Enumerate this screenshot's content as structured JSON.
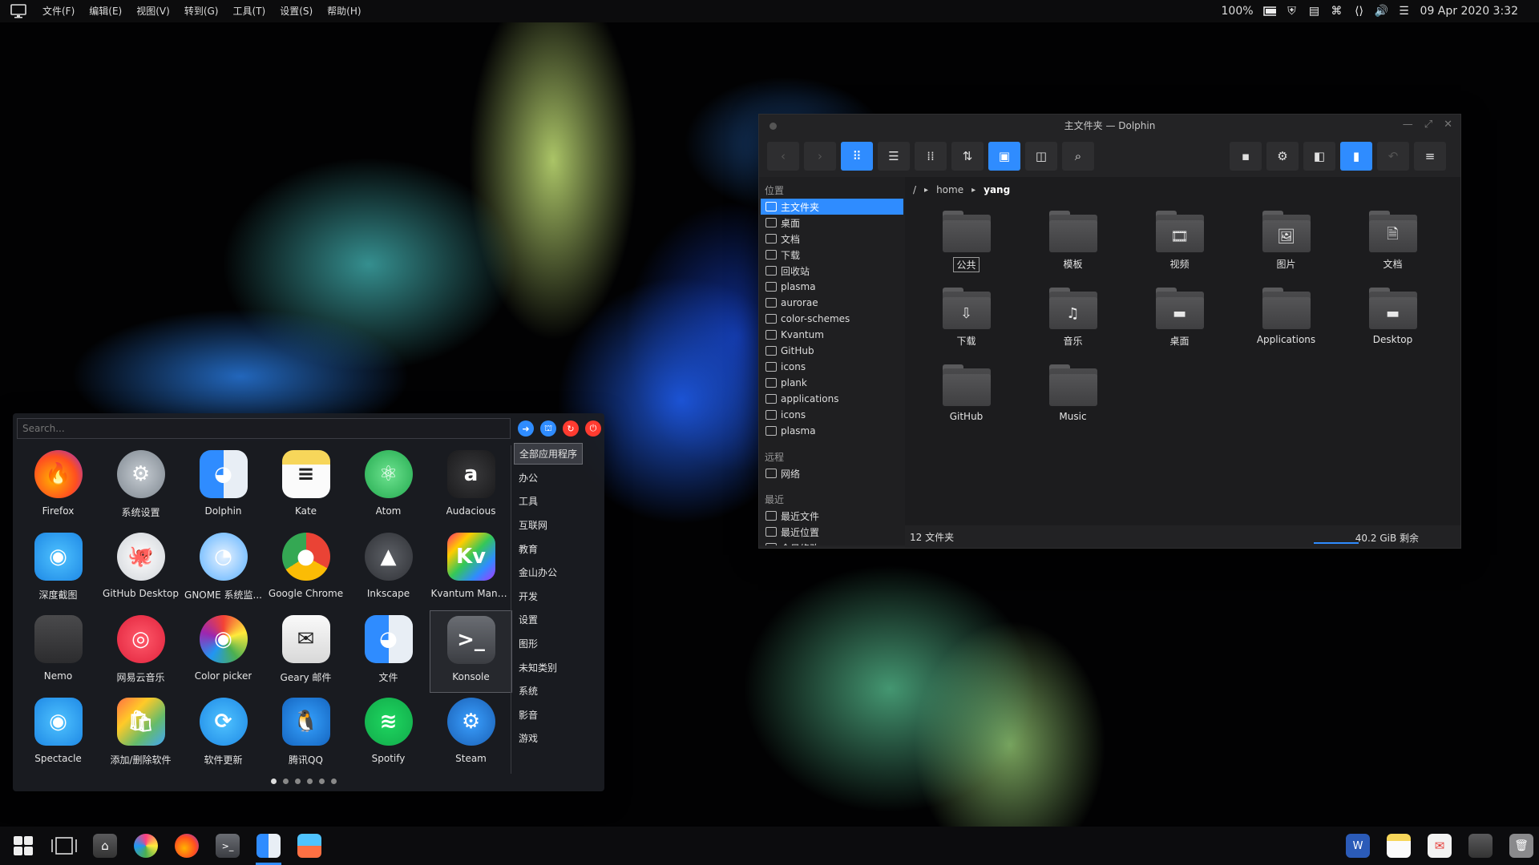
{
  "topbar": {
    "menu": [
      "文件(F)",
      "编辑(E)",
      "视图(V)",
      "转到(G)",
      "工具(T)",
      "设置(S)",
      "帮助(H)"
    ],
    "battery": "100%",
    "datetime": "09 Apr 2020 3:32"
  },
  "dolphin": {
    "title": "主文件夹 — Dolphin",
    "places_header": "位置",
    "places": [
      "主文件夹",
      "桌面",
      "文档",
      "下载",
      "回收站",
      "plasma",
      "aurorae",
      "color-schemes",
      "Kvantum",
      "GitHub",
      "icons",
      "plank",
      "applications",
      "icons",
      "plasma"
    ],
    "remote_header": "远程",
    "remote": [
      "网络"
    ],
    "recent_header": "最近",
    "recent": [
      "最近文件",
      "最近位置",
      "今日修改"
    ],
    "breadcrumb": [
      "/",
      "home",
      "yang"
    ],
    "files": [
      {
        "name": "公共",
        "glyph": ""
      },
      {
        "name": "模板",
        "glyph": ""
      },
      {
        "name": "视频",
        "glyph": "🎞"
      },
      {
        "name": "图片",
        "glyph": "🖼"
      },
      {
        "name": "文档",
        "glyph": "🗎"
      },
      {
        "name": "下载",
        "glyph": "⇩"
      },
      {
        "name": "音乐",
        "glyph": "♫"
      },
      {
        "name": "桌面",
        "glyph": "▬"
      },
      {
        "name": "Applications",
        "glyph": ""
      },
      {
        "name": "Desktop",
        "glyph": "▬"
      },
      {
        "name": "GitHub",
        "glyph": ""
      },
      {
        "name": "Music",
        "glyph": ""
      }
    ],
    "status": "12 文件夹",
    "free_space": "40.2 GiB 剩余"
  },
  "launcher": {
    "search_placeholder": "Search...",
    "apps": [
      {
        "name": "Firefox",
        "icon": "firefox-icon",
        "bg": "radial-gradient(circle at 40% 60%,#ffb300,#ff4f1f 55%,#8a2be2)",
        "glyph": "🔥"
      },
      {
        "name": "系统设置",
        "icon": "settings-icon",
        "bg": "radial-gradient(circle,#c7cdd3,#7d868f)",
        "glyph": "⚙"
      },
      {
        "name": "Dolphin",
        "icon": "dolphin-icon",
        "bg": "linear-gradient(90deg,#2f8cff 50%,#e8eef5 50%)",
        "glyph": "◕"
      },
      {
        "name": "Kate",
        "icon": "kate-icon",
        "bg": "linear-gradient(#f7d65a 30%,#fbfbfb 30%)",
        "glyph": "≡"
      },
      {
        "name": "Atom",
        "icon": "atom-icon",
        "bg": "radial-gradient(circle,#6de38f,#22a84e)",
        "glyph": "⚛"
      },
      {
        "name": "Audacious",
        "icon": "audacious-icon",
        "bg": "radial-gradient(circle,#3a3a3c,#1a1a1c)",
        "glyph": "a"
      },
      {
        "name": "深度截图",
        "icon": "screenshot-icon",
        "bg": "radial-gradient(circle,#4fc3ff,#1e88e5)",
        "glyph": "◉"
      },
      {
        "name": "GitHub Desktop",
        "icon": "github-icon",
        "bg": "radial-gradient(circle,#ffffff,#cfd3d8)",
        "glyph": "🐙"
      },
      {
        "name": "GNOME 系统监...",
        "icon": "monitor-icon",
        "bg": "radial-gradient(circle,#e6f2ff,#5ab0ff)",
        "glyph": "◔"
      },
      {
        "name": "Google Chrome",
        "icon": "chrome-icon",
        "bg": "conic-gradient(#ea4335 0 33%,#fbbc05 0 66%,#34a853 0)",
        "glyph": "●"
      },
      {
        "name": "Inkscape",
        "icon": "inkscape-icon",
        "bg": "radial-gradient(circle,#5d6066,#2f3136)",
        "glyph": "▲"
      },
      {
        "name": "Kvantum Mana...",
        "icon": "kvantum-icon",
        "bg": "linear-gradient(135deg,#ff2d6e,#ffcc00,#34c759,#2f8cff,#a838ff)",
        "glyph": "Kv"
      },
      {
        "name": "Nemo",
        "icon": "nemo-icon",
        "bg": "linear-gradient(#4a4a4c,#2c2c2e)",
        "glyph": ""
      },
      {
        "name": "网易云音乐",
        "icon": "netease-music-icon",
        "bg": "radial-gradient(circle,#ff5a6b,#e0213b)",
        "glyph": "◎"
      },
      {
        "name": "Color picker",
        "icon": "color-picker-icon",
        "bg": "conic-gradient(#f44336,#ffeb3b,#4caf50,#2196f3,#9c27b0,#f44336)",
        "glyph": "◉"
      },
      {
        "name": "Geary 邮件",
        "icon": "mail-icon",
        "bg": "linear-gradient(#fafafa,#d8d8d8)",
        "glyph": "✉"
      },
      {
        "name": "文件",
        "icon": "files-icon",
        "bg": "linear-gradient(90deg,#2f8cff 50%,#e8eef5 50%)",
        "glyph": "◕"
      },
      {
        "name": "Konsole",
        "icon": "konsole-icon",
        "bg": "linear-gradient(#6a6d73,#3b3d42)",
        "glyph": ">_"
      },
      {
        "name": "Spectacle",
        "icon": "spectacle-icon",
        "bg": "radial-gradient(circle,#4fc3ff,#1e88e5)",
        "glyph": "◉"
      },
      {
        "name": "添加/删除软件",
        "icon": "software-icon",
        "bg": "linear-gradient(135deg,#ff7043,#ffca28,#66bb6a,#42a5f5)",
        "glyph": "🛍"
      },
      {
        "name": "软件更新",
        "icon": "update-icon",
        "bg": "radial-gradient(circle,#4fc3ff,#1e88e5)",
        "glyph": "⟳"
      },
      {
        "name": "腾讯QQ",
        "icon": "qq-icon",
        "bg": "radial-gradient(circle,#36a3ff,#1565c0)",
        "glyph": "🐧"
      },
      {
        "name": "Spotify",
        "icon": "spotify-icon",
        "bg": "radial-gradient(circle,#1ed760,#12a94a)",
        "glyph": "≋"
      },
      {
        "name": "Steam",
        "icon": "steam-icon",
        "bg": "radial-gradient(circle,#3aa0ff,#1a5fb4)",
        "glyph": "⚙"
      }
    ],
    "categories": [
      "全部应用程序",
      "办公",
      "工具",
      "互联网",
      "教育",
      "金山办公",
      "开发",
      "设置",
      "图形",
      "未知类别",
      "系统",
      "影音",
      "游戏"
    ]
  },
  "taskbar": {
    "left": [
      "app-launcher-icon",
      "workspace-icon",
      "file-manager-icon",
      "color-icon",
      "firefox-icon",
      "terminal-icon",
      "dolphin-icon",
      "screenshot-icon"
    ],
    "right": [
      "word-icon",
      "notes-icon",
      "mail-icon",
      "folder-icon",
      "trash-icon"
    ]
  },
  "colors": {
    "accent": "#2f8cff"
  }
}
